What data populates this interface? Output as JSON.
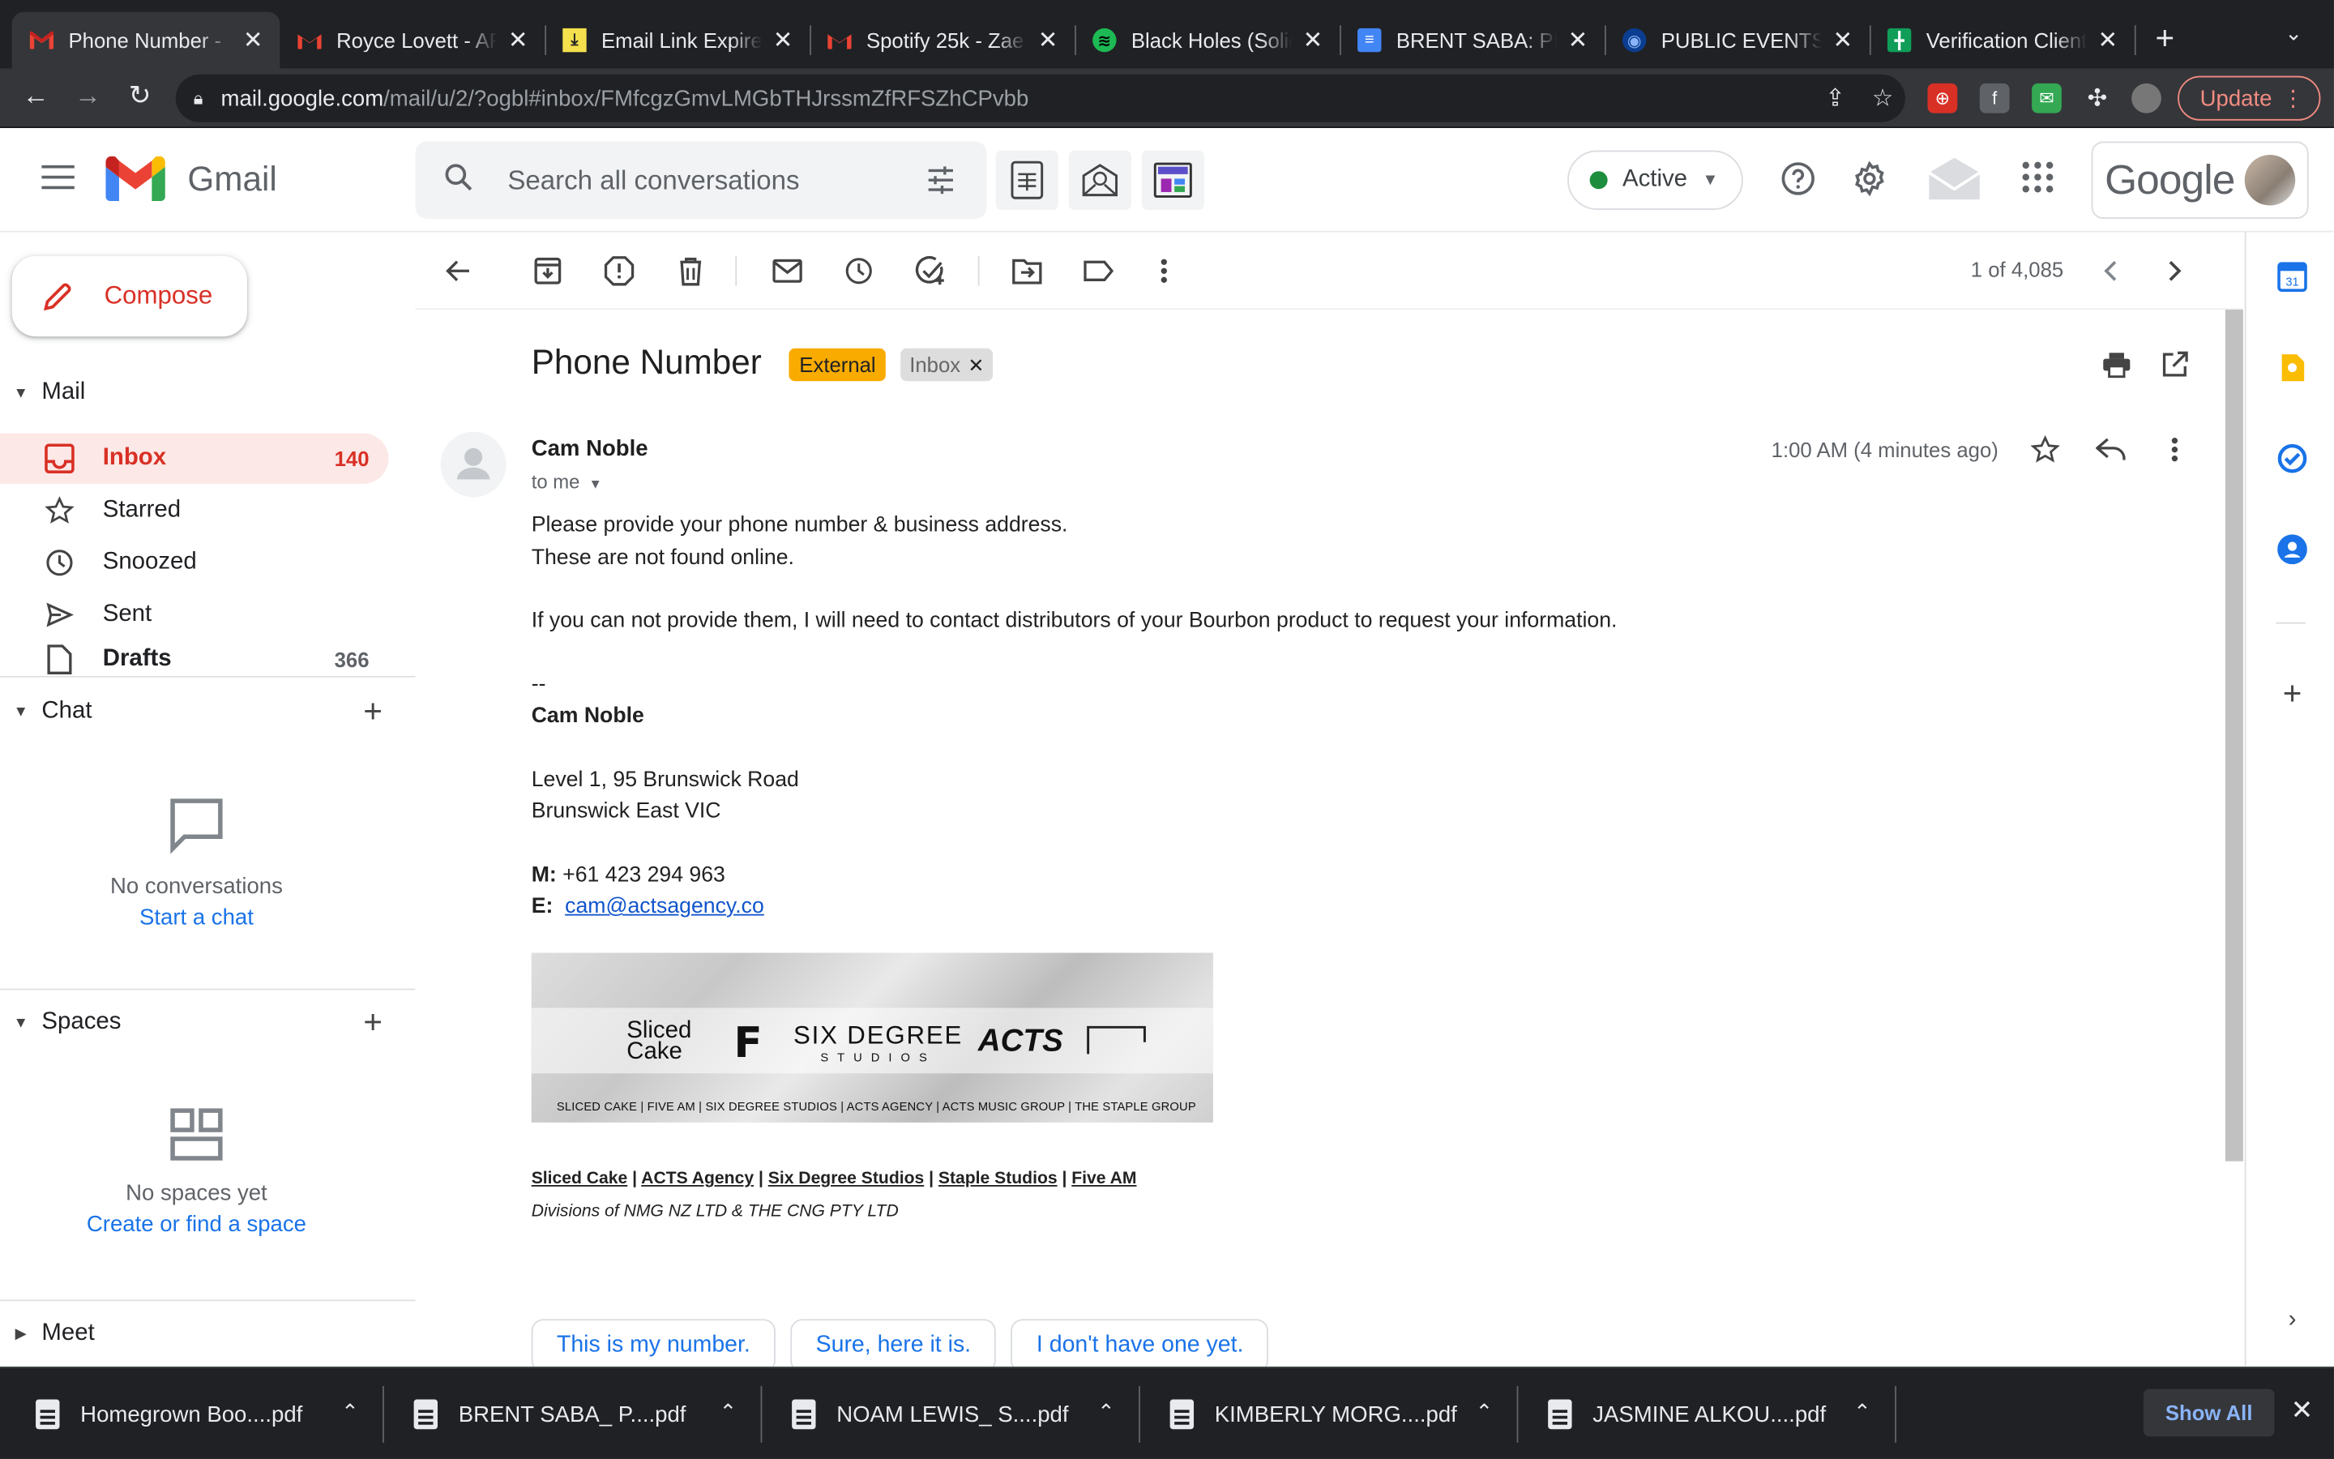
{
  "browser": {
    "tabs": [
      {
        "title": "Phone Number - "
      },
      {
        "title": "Royce Lovett - AR"
      },
      {
        "title": "Email Link Expired"
      },
      {
        "title": "Spotify 25k - Zae"
      },
      {
        "title": "Black Holes (Solid"
      },
      {
        "title": "BRENT SABA: PR"
      },
      {
        "title": "PUBLIC EVENTS -"
      },
      {
        "title": "Verification Client"
      }
    ],
    "url_host": "mail.google.com",
    "url_path": "/mail/u/2/?ogbl#inbox/FMfcgzGmvLMGbTHJrssmZfRFSZhCPvbb",
    "update_label": "Update"
  },
  "gmail": {
    "app_name": "Gmail",
    "search_placeholder": "Search all conversations",
    "status": "Active",
    "google_label": "Google",
    "compose_label": "Compose",
    "mail_section": "Mail",
    "nav": [
      {
        "label": "Inbox",
        "count": "140"
      },
      {
        "label": "Starred",
        "count": ""
      },
      {
        "label": "Snoozed",
        "count": ""
      },
      {
        "label": "Sent",
        "count": ""
      },
      {
        "label": "Drafts",
        "count": "366"
      }
    ],
    "chat": {
      "title": "Chat",
      "empty": "No conversations",
      "link": "Start a chat"
    },
    "spaces": {
      "title": "Spaces",
      "empty": "No spaces yet",
      "link": "Create or find a space"
    },
    "meet": {
      "title": "Meet"
    },
    "pager": "1 of 4,085"
  },
  "message": {
    "subject": "Phone Number",
    "label_external": "External",
    "label_inbox": "Inbox",
    "sender": "Cam Noble",
    "to": "to me",
    "time": "1:00 AM (4 minutes ago)",
    "body_line1": "Please provide your phone number & business address.",
    "body_line2": "These are not found online.",
    "body_line3": "If you can not provide them, I will need to contact distributors of your Bourbon product to request your information.",
    "sig_dash": "--",
    "sig_name": "Cam Noble",
    "addr1": "Level 1, 95 Brunswick Road",
    "addr2": "Brunswick East VIC",
    "mobile_label": "M:",
    "mobile": "+61 423 294 963",
    "email_label": "E:",
    "email": "cam@actsagency.co",
    "banner": {
      "logo1_a": "Sliced",
      "logo1_b": "Cake",
      "logo2": "F",
      "logo3_a": "SIX DEGREE",
      "logo3_b": "STUDIOS",
      "logo4": "ACTS",
      "footer": "SLICED CAKE  |  FIVE AM  | SIX DEGREE STUDIOS  |  ACTS AGENCY  | ACTS MUSIC GROUP  |  THE STAPLE GROUP"
    },
    "links": [
      "Sliced Cake",
      "ACTS Agency",
      "Six Degree Studios",
      "Staple Studios",
      "Five AM"
    ],
    "link_sep": " | ",
    "divisions": "Divisions of NMG NZ LTD & THE CNG PTY LTD",
    "smart_replies": [
      "This is my number.",
      "Sure, here it is.",
      "I don't have one yet."
    ]
  },
  "downloads": {
    "items": [
      "Homegrown Boo....pdf",
      "BRENT SABA_ P....pdf",
      "NOAM LEWIS_ S....pdf",
      "KIMBERLY MORG....pdf",
      "JASMINE ALKOU....pdf"
    ],
    "show_all": "Show All"
  }
}
